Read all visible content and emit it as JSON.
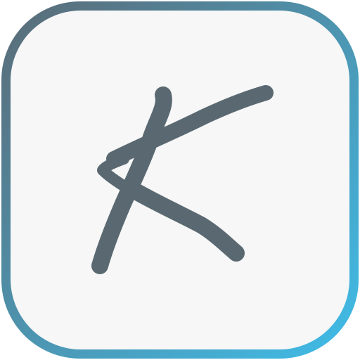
{
  "icon": {
    "name": "handwritten-k-app-icon",
    "glyph_letter": "K",
    "colors": {
      "border_gradient_start": "#5b6b76",
      "border_gradient_end": "#3fbde9",
      "tile_background": "#f7f7f7",
      "letter_stroke": "#5a6971"
    }
  }
}
